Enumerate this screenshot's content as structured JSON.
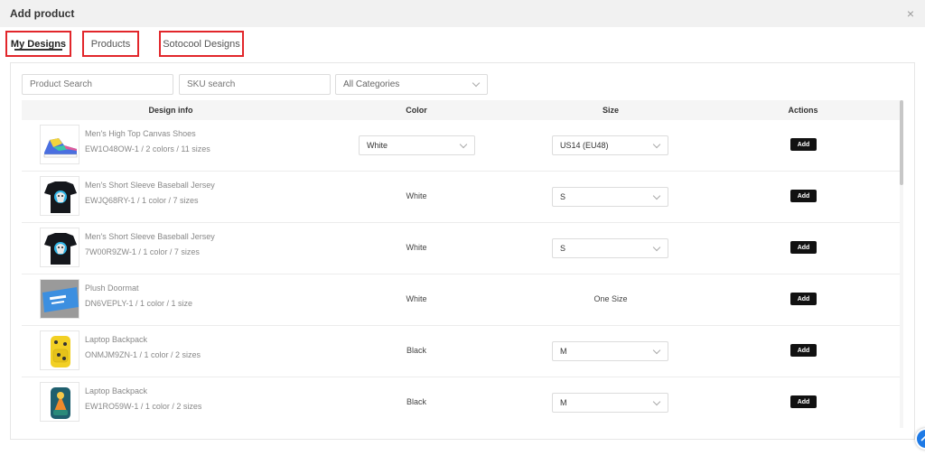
{
  "dialog": {
    "title": "Add product",
    "close_symbol": "×"
  },
  "tabs": [
    {
      "label": "My Designs",
      "active": true
    },
    {
      "label": "Products",
      "active": false
    },
    {
      "label": "Sotocool Designs",
      "active": false
    }
  ],
  "filters": {
    "product_search_placeholder": "Product Search",
    "sku_search_placeholder": "SKU search",
    "category_selected": "All Categories"
  },
  "table": {
    "headers": {
      "design_info": "Design info",
      "color": "Color",
      "size": "Size",
      "actions": "Actions"
    },
    "rows": [
      {
        "name": "Men's High Top Canvas Shoes",
        "sku": "EW1O48OW-1 / 2 colors / 11 sizes",
        "color": "White",
        "color_is_select": true,
        "size": "US14 (EU48)",
        "size_is_select": true,
        "action": "Add",
        "thumb": "sneaker-thumbnail"
      },
      {
        "name": "Men's Short Sleeve Baseball Jersey",
        "sku": "EWJQ68RY-1 / 1 color / 7 sizes",
        "color": "White",
        "color_is_select": false,
        "size": "S",
        "size_is_select": true,
        "action": "Add",
        "thumb": "jersey-thumbnail"
      },
      {
        "name": "Men's Short Sleeve Baseball Jersey",
        "sku": "7W00R9ZW-1 / 1 color / 7 sizes",
        "color": "White",
        "color_is_select": false,
        "size": "S",
        "size_is_select": true,
        "action": "Add",
        "thumb": "jersey-thumbnail"
      },
      {
        "name": "Plush Doormat",
        "sku": "DN6VEPLY-1 / 1 color / 1 size",
        "color": "White",
        "color_is_select": false,
        "size": "One Size",
        "size_is_select": false,
        "action": "Add",
        "thumb": "doormat-thumbnail"
      },
      {
        "name": "Laptop Backpack",
        "sku": "ONMJM9ZN-1 / 1 color / 2 sizes",
        "color": "Black",
        "color_is_select": false,
        "size": "M",
        "size_is_select": true,
        "action": "Add",
        "thumb": "backpack-yellow-thumbnail"
      },
      {
        "name": "Laptop Backpack",
        "sku": "EW1RO59W-1 / 1 color / 2 sizes",
        "color": "Black",
        "color_is_select": false,
        "size": "M",
        "size_is_select": true,
        "action": "Add",
        "thumb": "backpack-teal-thumbnail"
      }
    ]
  },
  "colors": {
    "tab_highlight": "#e2262b",
    "add_button": "#111111",
    "fab": "#1e7ae6"
  }
}
